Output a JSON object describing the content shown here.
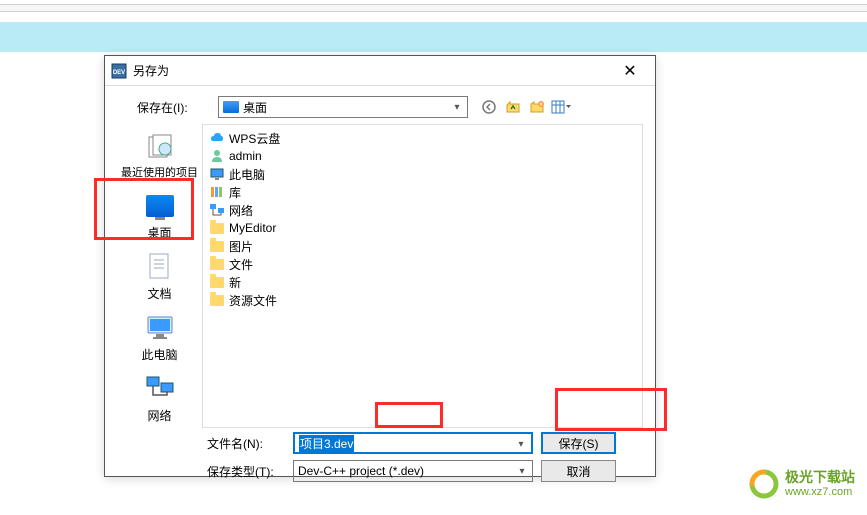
{
  "dialog": {
    "title": "另存为",
    "savein_label": "保存在(I):",
    "savein_value": "桌面",
    "filename_label": "文件名(N):",
    "filename_value": "项目3.dev",
    "filetype_label": "保存类型(T):",
    "filetype_value": "Dev-C++ project (*.dev)",
    "save_button": "保存(S)",
    "cancel_button": "取消"
  },
  "sidebar": {
    "items": [
      {
        "label": "最近使用的项目",
        "icon": "recent-icon"
      },
      {
        "label": "桌面",
        "icon": "desktop-icon"
      },
      {
        "label": "文档",
        "icon": "documents-icon"
      },
      {
        "label": "此电脑",
        "icon": "this-pc-icon"
      },
      {
        "label": "网络",
        "icon": "network-icon"
      }
    ]
  },
  "files": {
    "items": [
      {
        "label": "WPS云盘",
        "icon": "cloud-icon"
      },
      {
        "label": "admin",
        "icon": "user-icon"
      },
      {
        "label": "此电脑",
        "icon": "pc-icon"
      },
      {
        "label": "库",
        "icon": "library-icon"
      },
      {
        "label": "网络",
        "icon": "network-icon"
      },
      {
        "label": "MyEditor",
        "icon": "folder-icon"
      },
      {
        "label": "图片",
        "icon": "folder-icon"
      },
      {
        "label": "文件",
        "icon": "folder-icon"
      },
      {
        "label": "新",
        "icon": "folder-icon"
      },
      {
        "label": "资源文件",
        "icon": "folder-icon"
      }
    ]
  },
  "watermark": {
    "title": "极光下载站",
    "url": "www.xz7.com"
  }
}
